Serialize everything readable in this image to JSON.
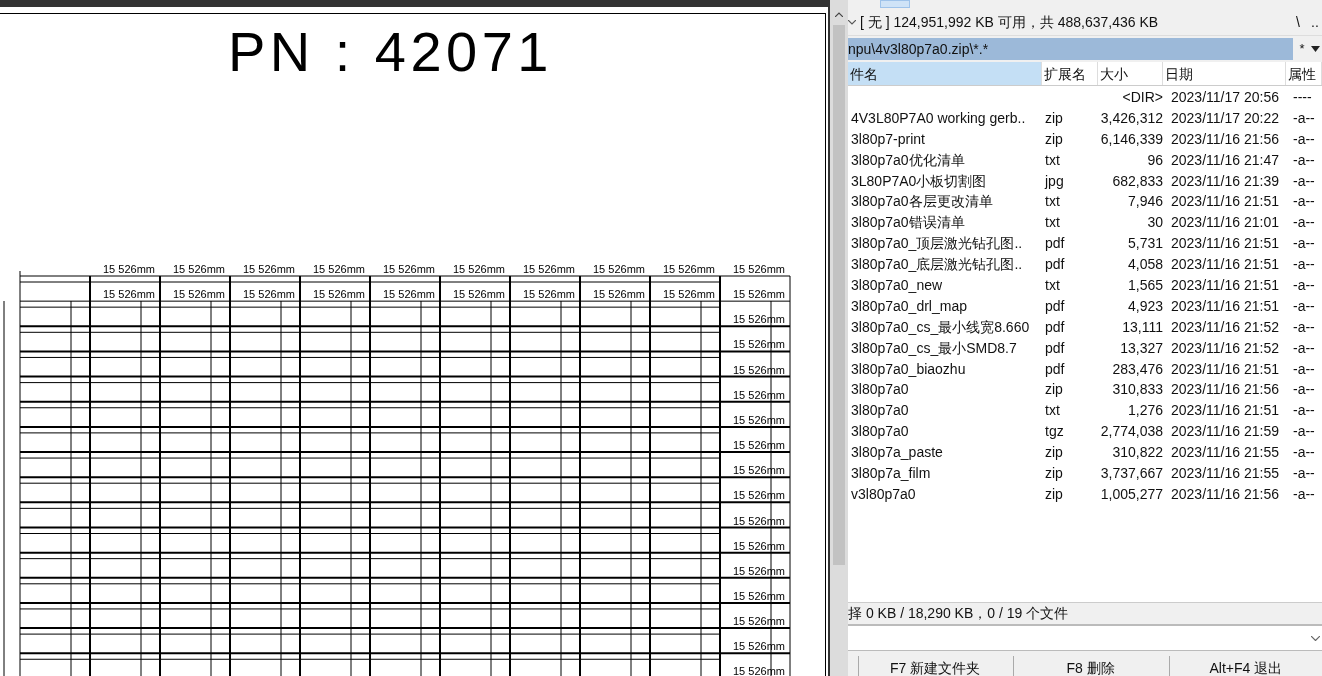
{
  "viewer": {
    "title": "PN : 42071",
    "dimension_rows": [
      {
        "labels": [
          "15 526mm",
          "15 526mm",
          "15 526mm",
          "15 526mm",
          "15 526mm",
          "15 526mm",
          "15 526mm",
          "15 526mm",
          "15 526mm",
          "15 526mm"
        ]
      },
      {
        "labels": [
          "15 526mm",
          "15 526mm",
          "15 526mm",
          "15 526mm",
          "15 526mm",
          "15 526mm",
          "15 526mm",
          "15 526mm",
          "15 526mm",
          "15 526mm"
        ]
      },
      {
        "labels": [
          "15 526mm"
        ]
      },
      {
        "labels": [
          "15 526mm"
        ]
      },
      {
        "labels": [
          "15 526mm"
        ]
      },
      {
        "labels": [
          "15 526mm"
        ]
      },
      {
        "labels": [
          "15 526mm"
        ]
      },
      {
        "labels": [
          "15 526mm"
        ]
      },
      {
        "labels": [
          "15 526mm"
        ]
      },
      {
        "labels": [
          "15 526mm"
        ]
      },
      {
        "labels": [
          "15 526mm"
        ]
      },
      {
        "labels": [
          "15 526mm"
        ]
      },
      {
        "labels": [
          "15 526mm"
        ]
      },
      {
        "labels": [
          "15 526mm"
        ]
      },
      {
        "labels": [
          "15 526mm"
        ]
      },
      {
        "labels": [
          "15 526mm"
        ]
      },
      {
        "labels": [
          "15 526mm"
        ]
      }
    ]
  },
  "file_panel": {
    "drive_info": "[ 无 ] 124,951,992 KB 可用，共 488,637,436 KB",
    "root_button": "\\",
    "parent_button": "..",
    "path": "npu\\4v3l80p7a0.zip\\*.*",
    "filter": "*",
    "columns": [
      {
        "label": "件名",
        "selected": true
      },
      {
        "label": "扩展名",
        "selected": false
      },
      {
        "label": "大小",
        "selected": false
      },
      {
        "label": "日期",
        "selected": false
      },
      {
        "label": "属性",
        "selected": false
      }
    ],
    "rows": [
      {
        "ext": "",
        "size": "<DIR>",
        "date": "2023/11/17 20:56",
        "attr": "----"
      },
      {
        "name": "4V3L80P7A0 working gerb..",
        "ext": "zip",
        "size": "3,426,312",
        "date": "2023/11/17 20:22",
        "attr": "-a--"
      },
      {
        "name": "3l80p7-print",
        "ext": "zip",
        "size": "6,146,339",
        "date": "2023/11/16 21:56",
        "attr": "-a--"
      },
      {
        "name": "3l80p7a0优化清单",
        "ext": "txt",
        "size": "96",
        "date": "2023/11/16 21:47",
        "attr": "-a--"
      },
      {
        "name": "3L80P7A0小板切割图",
        "ext": "jpg",
        "size": "682,833",
        "date": "2023/11/16 21:39",
        "attr": "-a--"
      },
      {
        "name": "3l80p7a0各层更改清单",
        "ext": "txt",
        "size": "7,946",
        "date": "2023/11/16 21:51",
        "attr": "-a--"
      },
      {
        "name": "3l80p7a0错误清单",
        "ext": "txt",
        "size": "30",
        "date": "2023/11/16 21:01",
        "attr": "-a--"
      },
      {
        "name": "3l80p7a0_顶层激光钻孔图..",
        "ext": "pdf",
        "size": "5,731",
        "date": "2023/11/16 21:51",
        "attr": "-a--"
      },
      {
        "name": "3l80p7a0_底层激光钻孔图..",
        "ext": "pdf",
        "size": "4,058",
        "date": "2023/11/16 21:51",
        "attr": "-a--"
      },
      {
        "name": "3l80p7a0_new",
        "ext": "txt",
        "size": "1,565",
        "date": "2023/11/16 21:51",
        "attr": "-a--"
      },
      {
        "name": "3l80p7a0_drl_map",
        "ext": "pdf",
        "size": "4,923",
        "date": "2023/11/16 21:51",
        "attr": "-a--"
      },
      {
        "name": "3l80p7a0_cs_最小线宽8.660",
        "ext": "pdf",
        "size": "13,111",
        "date": "2023/11/16 21:52",
        "attr": "-a--"
      },
      {
        "name": "3l80p7a0_cs_最小SMD8.7",
        "ext": "pdf",
        "size": "13,327",
        "date": "2023/11/16 21:52",
        "attr": "-a--"
      },
      {
        "name": "3l80p7a0_biaozhu",
        "ext": "pdf",
        "size": "283,476",
        "date": "2023/11/16 21:51",
        "attr": "-a--"
      },
      {
        "name": "3l80p7a0",
        "ext": "zip",
        "size": "310,833",
        "date": "2023/11/16 21:56",
        "attr": "-a--"
      },
      {
        "name": "3l80p7a0",
        "ext": "txt",
        "size": "1,276",
        "date": "2023/11/16 21:51",
        "attr": "-a--"
      },
      {
        "name": "3l80p7a0",
        "ext": "tgz",
        "size": "2,774,038",
        "date": "2023/11/16 21:59",
        "attr": "-a--"
      },
      {
        "name": "3l80p7a_paste",
        "ext": "zip",
        "size": "310,822",
        "date": "2023/11/16 21:55",
        "attr": "-a--"
      },
      {
        "name": "3l80p7a_film",
        "ext": "zip",
        "size": "3,737,667",
        "date": "2023/11/16 21:55",
        "attr": "-a--"
      },
      {
        "name": "v3l80p7a0",
        "ext": "zip",
        "size": "1,005,277",
        "date": "2023/11/16 21:56",
        "attr": "-a--"
      }
    ],
    "status": "择 0 KB / 18,290 KB，0 / 19 个文件",
    "buttons": [
      "F7 新建文件夹",
      "F8 删除",
      "Alt+F4 退出"
    ]
  }
}
